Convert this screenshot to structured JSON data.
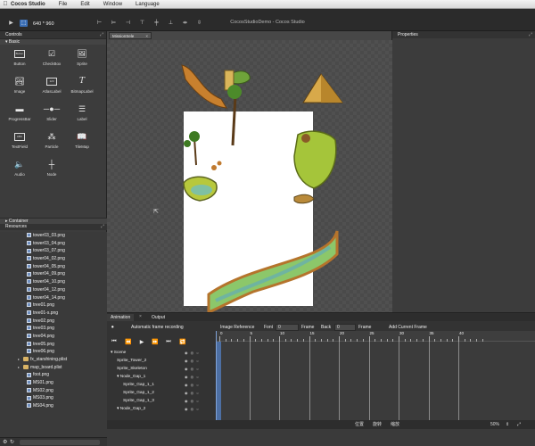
{
  "menubar": {
    "items": [
      "Cocos Studio",
      "File",
      "Edit",
      "Window",
      "Language"
    ]
  },
  "toolbar": {
    "resolution": "640 * 960",
    "window_title": "CocosStudioDemo - Cocos Studio"
  },
  "controls_panel": {
    "title": "Controls",
    "section_basic": "Basic",
    "items": [
      {
        "label": "Button",
        "icon": "button-icon"
      },
      {
        "label": "CheckBox",
        "icon": "checkbox-icon"
      },
      {
        "label": "Sprite",
        "icon": "sprite-icon"
      },
      {
        "label": "Image",
        "icon": "image-icon"
      },
      {
        "label": "AtlasLabel",
        "icon": "atlaslabel-icon"
      },
      {
        "label": "BitmapLabel",
        "icon": "bitmaplabel-icon"
      },
      {
        "label": "ProgressBar",
        "icon": "progressbar-icon"
      },
      {
        "label": "Slider",
        "icon": "slider-icon"
      },
      {
        "label": "Label",
        "icon": "label-icon"
      },
      {
        "label": "TextField",
        "icon": "textfield-icon"
      },
      {
        "label": "Particle",
        "icon": "particle-icon"
      },
      {
        "label": "TileMap",
        "icon": "tilemap-icon"
      },
      {
        "label": "Audio",
        "icon": "audio-icon"
      },
      {
        "label": "Node",
        "icon": "node-icon"
      }
    ],
    "section_container": "Container"
  },
  "resources_panel": {
    "title": "Resources",
    "items": [
      {
        "name": "tower03_03.png",
        "type": "file"
      },
      {
        "name": "tower03_04.png",
        "type": "file"
      },
      {
        "name": "tower03_07.png",
        "type": "file"
      },
      {
        "name": "tower04_02.png",
        "type": "file"
      },
      {
        "name": "tower04_05.png",
        "type": "file"
      },
      {
        "name": "tower04_09.png",
        "type": "file"
      },
      {
        "name": "tower04_10.png",
        "type": "file"
      },
      {
        "name": "tower04_12.png",
        "type": "file"
      },
      {
        "name": "tower04_14.png",
        "type": "file"
      },
      {
        "name": "tree01.png",
        "type": "file"
      },
      {
        "name": "tree01-s.png",
        "type": "file"
      },
      {
        "name": "tree02.png",
        "type": "file"
      },
      {
        "name": "tree03.png",
        "type": "file"
      },
      {
        "name": "tree04.png",
        "type": "file"
      },
      {
        "name": "tree05.png",
        "type": "file"
      },
      {
        "name": "tree06.png",
        "type": "file"
      },
      {
        "name": "fx_starshining.plist",
        "type": "folder"
      },
      {
        "name": "map_board.plist",
        "type": "folder"
      },
      {
        "name": "foot.png",
        "type": "file"
      },
      {
        "name": "MS01.png",
        "type": "file"
      },
      {
        "name": "MS02.png",
        "type": "file"
      },
      {
        "name": "MS03.png",
        "type": "file"
      },
      {
        "name": "MS04.png",
        "type": "file"
      }
    ]
  },
  "editor": {
    "tab_label": "MissionSele",
    "tab_close": "×"
  },
  "properties_panel": {
    "title": "Properties"
  },
  "animation_panel": {
    "tabs": [
      "Animation",
      "Output"
    ],
    "auto_record_label": "Automatic frame recording",
    "image_reference_label": "Image Reference",
    "font_label": "Font",
    "font_value": "0",
    "frame_label": "Frame",
    "back_label": "Back",
    "back_value": "0",
    "frame_label2": "Frame",
    "add_current_frame": "Add Current Frame",
    "ruler_labels": [
      "0",
      "5",
      "10",
      "15",
      "20",
      "25",
      "30",
      "35",
      "40"
    ],
    "tree": [
      {
        "label": "Scene",
        "indent": 0,
        "expanded": true
      },
      {
        "label": "Sprite_Tower_2",
        "indent": 1
      },
      {
        "label": "Sprite_Skeleton",
        "indent": 1
      },
      {
        "label": "Node_Gap_1",
        "indent": 1,
        "expanded": true
      },
      {
        "label": "Sprite_Gap_1_1",
        "indent": 2
      },
      {
        "label": "Sprite_Gap_1_2",
        "indent": 2
      },
      {
        "label": "Sprite_Gap_1_3",
        "indent": 2
      },
      {
        "label": "Node_Gap_2",
        "indent": 1,
        "expanded": true
      }
    ]
  },
  "statusbar": {
    "position_label": "位置",
    "rotation_label": "旋转",
    "scale_label": "缩放",
    "zoom": "50%"
  },
  "colors": {
    "accent": "#3b6fb6",
    "panel": "#3c3c3c",
    "canvas": "#474747"
  }
}
